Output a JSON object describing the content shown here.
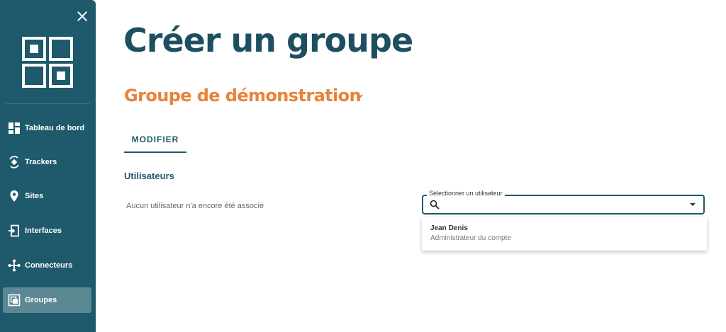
{
  "sidebar": {
    "items": [
      {
        "label": "Tableau de bord",
        "icon": "dashboard-icon"
      },
      {
        "label": "Trackers",
        "icon": "tracker-icon"
      },
      {
        "label": "Sites",
        "icon": "location-pin-icon"
      },
      {
        "label": "Interfaces",
        "icon": "interface-icon"
      },
      {
        "label": "Connecteurs",
        "icon": "connector-icon"
      },
      {
        "label": "Groupes",
        "icon": "group-icon",
        "active": true
      }
    ]
  },
  "main": {
    "title": "Créer un groupe",
    "group_name": "Groupe de démonstration",
    "tabs": [
      {
        "label": "MODIFIER"
      }
    ],
    "users_section": {
      "title": "Utilisateurs",
      "empty_text": "Aucun utilisateur n'a encore été associé"
    },
    "user_select": {
      "label": "Sélectionner un utilisateur",
      "value": "",
      "options": [
        {
          "name": "Jean Denis",
          "role": "Administrateur du compte"
        }
      ]
    }
  },
  "colors": {
    "sidebar_bg": "#1e5a6b",
    "title": "#1e4f60",
    "accent_orange": "#e8833a",
    "primary": "#1e5a6b"
  }
}
